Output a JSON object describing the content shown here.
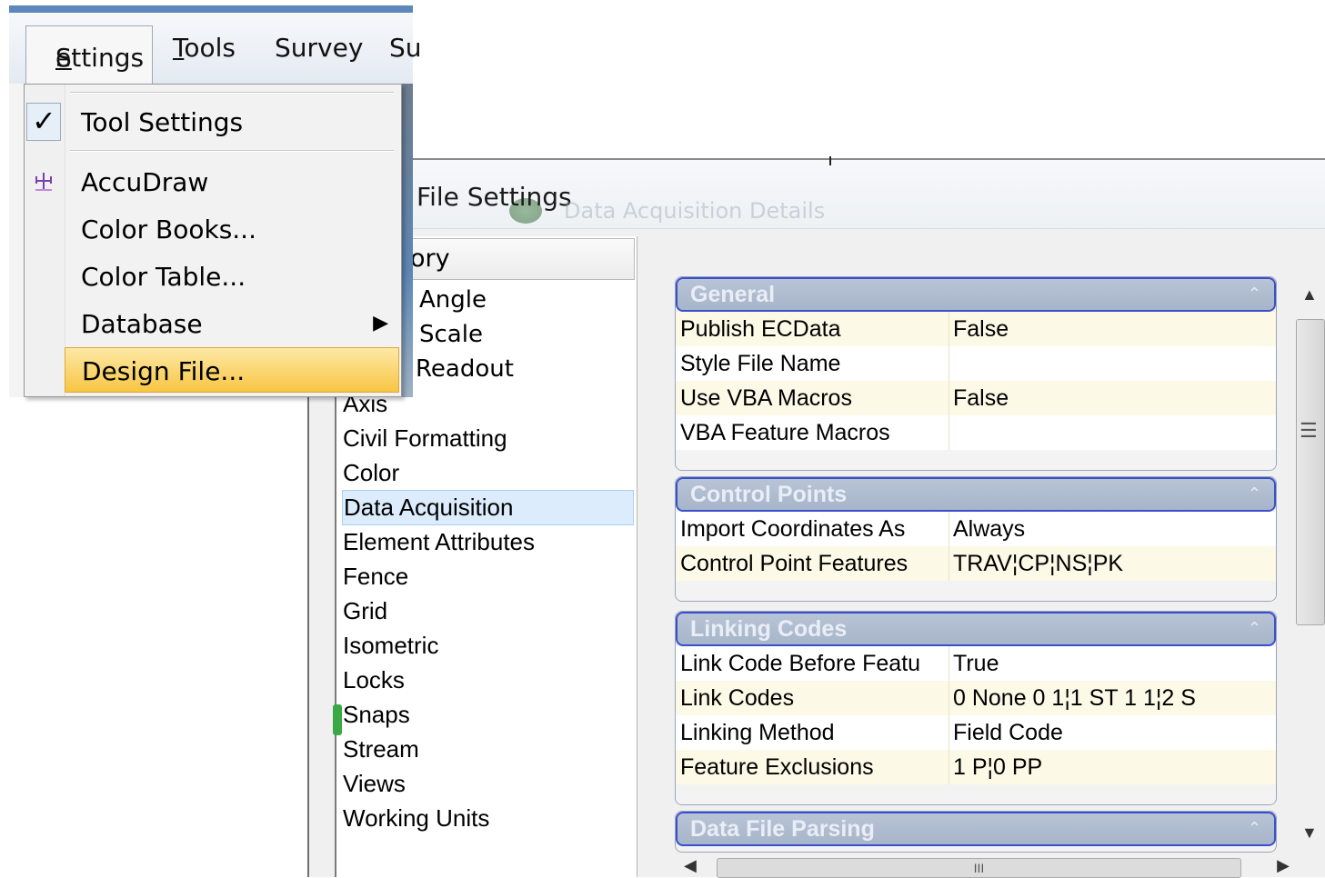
{
  "dialog": {
    "title": "File Settings",
    "ghost_title": "Data Acquisition Details",
    "category_header": "ory",
    "categories_top": [
      "Angle",
      "Scale",
      "Readout"
    ],
    "categories": [
      "Axis",
      "Civil Formatting",
      "Color",
      "Data Acquisition",
      "Element Attributes",
      "Fence",
      "Grid",
      "Isometric",
      "Locks",
      "Snaps",
      "Stream",
      "Views",
      "Working Units"
    ],
    "selected_category": "Data Acquisition",
    "groups": [
      {
        "title": "General",
        "rows": [
          {
            "name": "Publish ECData",
            "value": "False"
          },
          {
            "name": "Style File Name",
            "value": ""
          },
          {
            "name": "Use VBA Macros",
            "value": "False"
          },
          {
            "name": "VBA Feature Macros",
            "value": ""
          }
        ]
      },
      {
        "title": "Control Points",
        "rows": [
          {
            "name": "Import Coordinates As",
            "value": "Always"
          },
          {
            "name": "Control Point Features",
            "value": "TRAV¦CP¦NS¦PK"
          }
        ]
      },
      {
        "title": "Linking Codes",
        "rows": [
          {
            "name": "Link Code Before Featu",
            "value": "True"
          },
          {
            "name": "Link Codes",
            "value": "0 None 0 1¦1 ST 1 1¦2 S"
          },
          {
            "name": "Linking Method",
            "value": "Field Code"
          },
          {
            "name": "Feature  Exclusions",
            "value": "1 P¦0 PP"
          }
        ]
      },
      {
        "title": "Data File Parsing",
        "rows": []
      }
    ],
    "collapse_glyph": "⌃",
    "scroll_grip": "☰",
    "hscroll_grip": "III"
  },
  "menubar": {
    "items": [
      "Settings",
      "Tools",
      "Survey",
      "Su"
    ]
  },
  "menu": {
    "items": [
      {
        "label": "Tool Settings",
        "checked": true
      },
      {
        "label": "AccuDraw"
      },
      {
        "label": "Color Books..."
      },
      {
        "label": "Color Table..."
      },
      {
        "label": "Database",
        "submenu": true
      },
      {
        "label": "Design File...",
        "highlighted": true
      }
    ],
    "arrow": "▶",
    "check": "✓"
  },
  "colors": {
    "group_header": "#a7b5ca",
    "highlight": "#f8c542",
    "selection": "#dcecfc"
  }
}
